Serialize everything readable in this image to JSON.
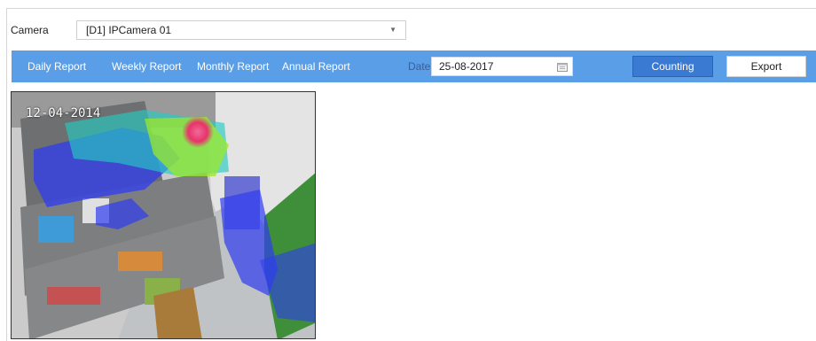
{
  "camera": {
    "label": "Camera",
    "selected": "[D1] IPCamera 01"
  },
  "report_tabs": [
    "Daily Report",
    "Weekly Report",
    "Monthly Report",
    "Annual Report"
  ],
  "date": {
    "label": "Date",
    "value": "25-08-2017"
  },
  "buttons": {
    "counting": "Counting",
    "export": "Export"
  },
  "heatmap": {
    "timestamp": "12-04-2014",
    "colors": {
      "low": "#2f3cf0",
      "mid": "#27c9c0",
      "high": "#9be82a",
      "peak": "#e8336a"
    }
  },
  "colors": {
    "toolbar": "#5b9ee8",
    "accent_button": "#3b7ad2"
  },
  "icons": {
    "dropdown": "chevron-down-icon",
    "calendar": "calendar-icon"
  }
}
